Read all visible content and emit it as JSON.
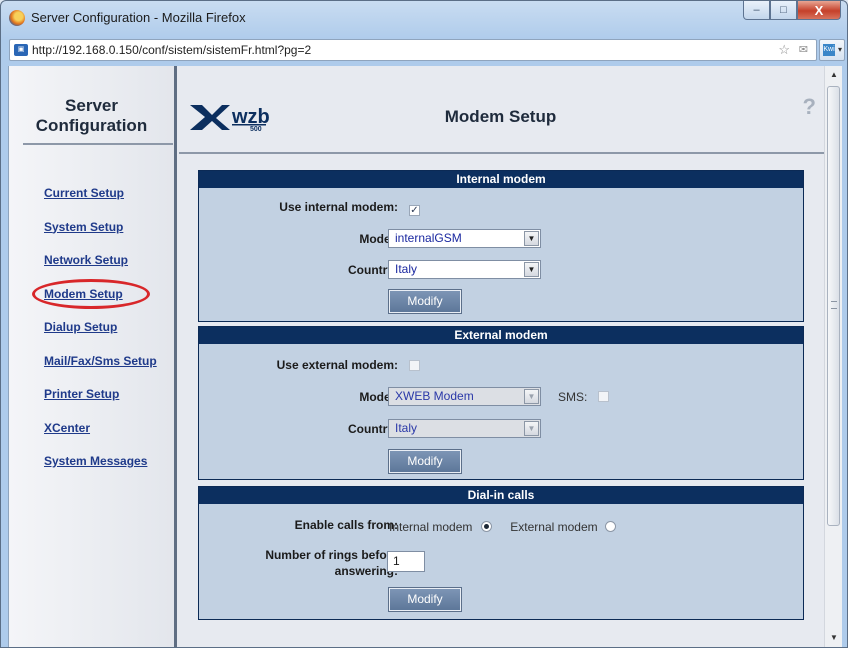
{
  "window": {
    "title": "Server Configuration - Mozilla Firefox",
    "url": "http://192.168.0.150/conf/sistem/sistemFr.html?pg=2",
    "controls": {
      "minimize": "–",
      "maximize": "□",
      "close": "X"
    },
    "ext_icon_text": "Kwi"
  },
  "sidebar": {
    "title_line1": "Server",
    "title_line2": "Configuration",
    "links": [
      "Current Setup",
      "System Setup",
      "Network Setup",
      "Modem Setup",
      "Dialup Setup",
      "Mail/Fax/Sms Setup",
      "Printer Setup",
      "XCenter",
      "System Messages"
    ],
    "highlighted": "Modem Setup",
    "highlight_color": "#d8272a"
  },
  "header": {
    "logo_text": "wzb",
    "logo_sub": "500",
    "page_title": "Modem Setup",
    "help": "?"
  },
  "internal_modem": {
    "title": "Internal modem",
    "use_label": "Use internal modem:",
    "use_checked": true,
    "check_mark": "✓",
    "model_label": "Model:",
    "model_value": "internalGSM",
    "country_label": "Country:",
    "country_value": "Italy",
    "button": "Modify"
  },
  "external_modem": {
    "title": "External modem",
    "use_label": "Use external modem:",
    "use_checked": false,
    "model_label": "Model:",
    "model_value": "XWEB Modem",
    "sms_label": "SMS:",
    "country_label": "Country:",
    "country_value": "Italy",
    "button": "Modify"
  },
  "dial_in": {
    "title": "Dial-in calls",
    "enable_label": "Enable calls from:",
    "option_internal": "Internal modem",
    "option_external": "External modem",
    "selected": "Internal modem",
    "rings_label_line1": "Number of rings before",
    "rings_label_line2": "answering:",
    "rings_value": "1",
    "button": "Modify"
  },
  "colors": {
    "panel_header": "#0c2f5f",
    "panel_body": "#c2d1e2",
    "link": "#1f3a8a",
    "button": "#6a84a6"
  }
}
